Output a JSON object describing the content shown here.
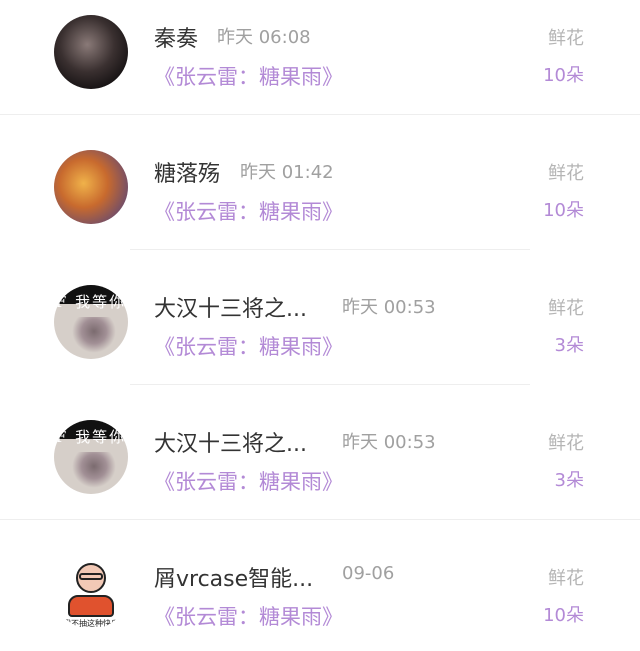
{
  "rows": [
    {
      "name": "秦奏",
      "time": "昨天 06:08",
      "song": "《张云雷：糖果雨》",
      "gift_type": "鲜花",
      "gift_count": "10朵"
    },
    {
      "name": "糖落殇",
      "time": "昨天 01:42",
      "song": "《张云雷：糖果雨》",
      "gift_type": "鲜花",
      "gift_count": "10朵"
    },
    {
      "name": "大汉十三将之...",
      "time": "昨天 00:53",
      "song": "《张云雷：糖果雨》",
      "gift_type": "鲜花",
      "gift_count": "3朵",
      "avatar_text": "F 我等你"
    },
    {
      "name": "大汉十三将之...",
      "time": "昨天 00:53",
      "song": "《张云雷：糖果雨》",
      "gift_type": "鲜花",
      "gift_count": "3朵",
      "avatar_text": "F 我等你"
    },
    {
      "name": "屑vrcase智能...",
      "time": "09-06",
      "song": "《张云雷：糖果雨》",
      "gift_type": "鲜花",
      "gift_count": "10朵",
      "avatar_text": "我不抽这种快乐"
    }
  ],
  "colors": {
    "accent": "#b38ad6",
    "name": "#333333",
    "muted": "#a0a0a0",
    "divider": "#eeeeee"
  }
}
